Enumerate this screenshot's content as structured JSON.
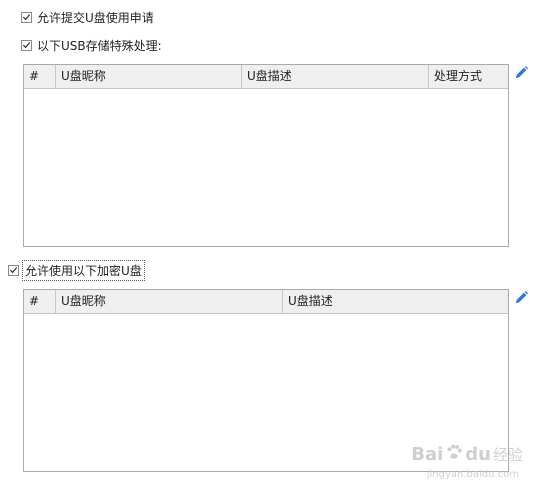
{
  "options": {
    "allow_submit_label": "允许提交U盘使用申请",
    "special_usb_label": "以下USB存储特殊处理:",
    "allow_encrypted_label": "允许使用以下加密U盘"
  },
  "special_usb_table": {
    "columns": [
      "#",
      "U盘昵称",
      "U盘描述",
      "处理方式"
    ],
    "rows": []
  },
  "encrypted_usb_table": {
    "columns": [
      "#",
      "U盘昵称",
      "U盘描述"
    ],
    "rows": []
  },
  "colors": {
    "edit_icon": "#2a7ad6",
    "header_bg": "#efefef",
    "border": "#aaaaaa"
  },
  "watermark": {
    "text_left": "Bai",
    "text_right": "du",
    "text_jy": "经验",
    "url": "jingyan.baidu.com"
  }
}
